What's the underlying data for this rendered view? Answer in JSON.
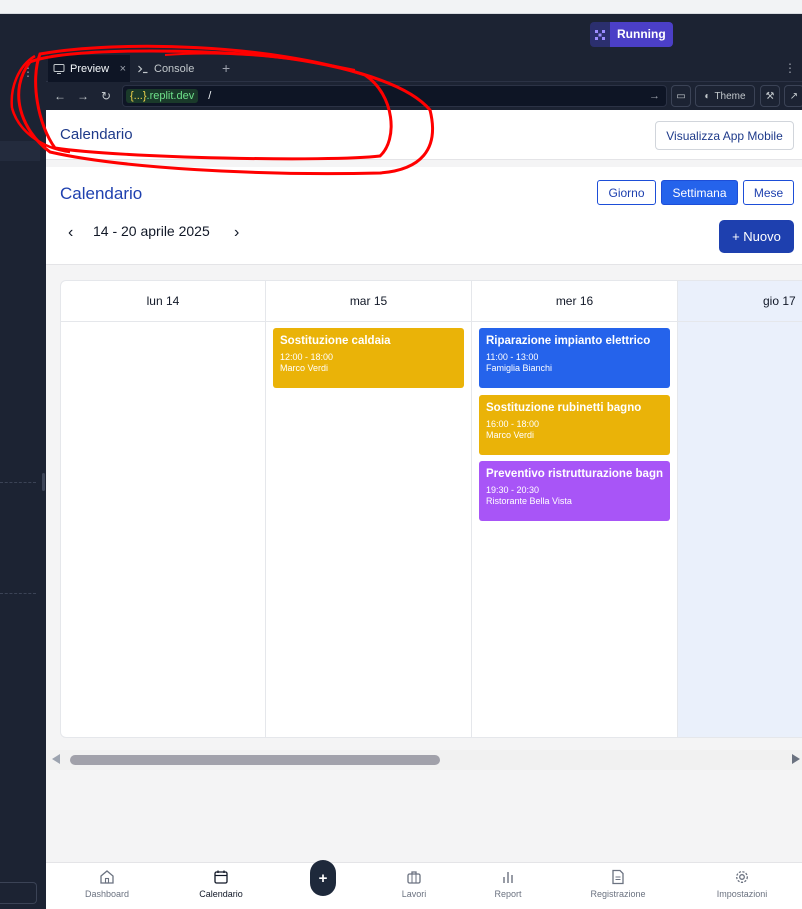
{
  "topbar": {
    "run_label": "Running"
  },
  "tabs": [
    {
      "label": "Preview",
      "close": "×"
    },
    {
      "label": "Console"
    }
  ],
  "tab_add": "+",
  "urlbar": {
    "host_brace": "{...}",
    "host": ".replit.dev",
    "path": "/",
    "theme_label": "Theme"
  },
  "app": {
    "header_title": "Calendario",
    "mobile_button": "Visualizza App Mobile",
    "calendar_title": "Calendario",
    "views": [
      "Giorno",
      "Settimana",
      "Mese"
    ],
    "active_view": "Settimana",
    "range": "14 - 20 aprile 2025",
    "new_button": "+ Nuovo",
    "days": [
      {
        "label": "lun 14",
        "events": []
      },
      {
        "label": "mar 15",
        "events": [
          {
            "title": "Sostituzione caldaia",
            "time": "12:00 - 18:00",
            "client": "Marco Verdi",
            "color": "#eab308"
          }
        ]
      },
      {
        "label": "mer 16",
        "events": [
          {
            "title": "Riparazione impianto elettrico",
            "time": "11:00 - 13:00",
            "client": "Famiglia Bianchi",
            "color": "#2563eb"
          },
          {
            "title": "Sostituzione rubinetti bagno",
            "time": "16:00 - 18:00",
            "client": "Marco Verdi",
            "color": "#eab308"
          },
          {
            "title": "Preventivo ristrutturazione bagno",
            "time": "19:30 - 20:30",
            "client": "Ristorante Bella Vista",
            "color": "#a855f7"
          }
        ]
      },
      {
        "label": "gio 17",
        "events": [],
        "today": true
      }
    ]
  },
  "bottom_nav": [
    {
      "label": "Dashboard",
      "icon": "home-icon"
    },
    {
      "label": "Calendario",
      "icon": "calendar-icon",
      "active": true
    },
    {
      "label": "+",
      "icon": "add-icon"
    },
    {
      "label": "Lavori",
      "icon": "briefcase-icon"
    },
    {
      "label": "Report",
      "icon": "bar-chart-icon"
    },
    {
      "label": "Registrazione",
      "icon": "document-icon"
    },
    {
      "label": "Impostazioni",
      "icon": "gear-icon"
    }
  ],
  "colors": {
    "accent": "#1e40af",
    "running": "#4b3fc7",
    "annotation": "#ff0000"
  }
}
